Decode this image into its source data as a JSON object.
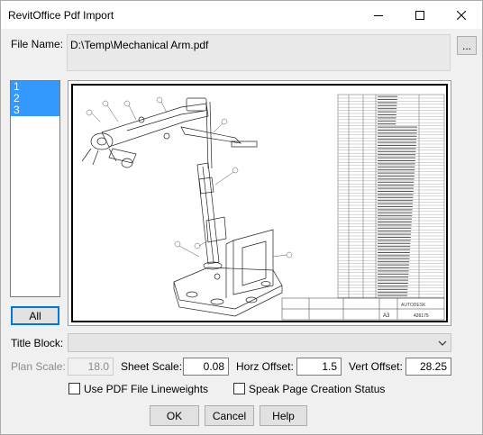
{
  "window": {
    "title": "RevitOffice Pdf Import"
  },
  "file": {
    "label": "File Name:",
    "path": "D:\\Temp\\Mechanical Arm.pdf",
    "browse_label": "..."
  },
  "pages": {
    "items": [
      "1",
      "2",
      "3"
    ],
    "all_label": "All"
  },
  "preview": {
    "title_block": {
      "company": "AUTODESK",
      "sheet": "A3",
      "drawing_no": "426175"
    }
  },
  "title_block": {
    "label": "Title Block:",
    "value": ""
  },
  "plan_scale": {
    "label": "Plan Scale:",
    "value": "18.0"
  },
  "sheet_scale": {
    "label": "Sheet Scale:",
    "value": "0.08"
  },
  "horz_offset": {
    "label": "Horz Offset:",
    "value": "1.5"
  },
  "vert_offset": {
    "label": "Vert Offset:",
    "value": "28.25"
  },
  "options": {
    "lineweights_label": "Use PDF File Lineweights",
    "lineweights_checked": false,
    "speak_label": "Speak Page Creation Status",
    "speak_checked": false
  },
  "buttons": {
    "ok": "OK",
    "cancel": "Cancel",
    "help": "Help"
  },
  "colors": {
    "selection": "#3399ff",
    "focus_border": "#0078d7"
  }
}
